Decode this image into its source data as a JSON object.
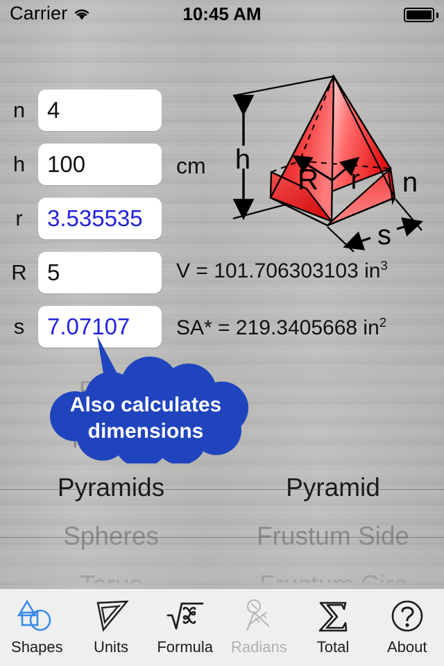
{
  "status_bar": {
    "carrier": "Carrier",
    "wifi_icon": "wifi-icon",
    "time": "10:45 AM",
    "battery_icon": "battery-icon"
  },
  "inputs": {
    "rows": [
      {
        "label": "n",
        "value": "4",
        "computed": false
      },
      {
        "label": "h",
        "value": "100",
        "computed": false
      },
      {
        "label": "r",
        "value": "3.535535",
        "computed": true
      },
      {
        "label": "R",
        "value": "5",
        "computed": false
      },
      {
        "label": "s",
        "value": "7.07107",
        "computed": true
      }
    ],
    "unit_label": "cm"
  },
  "results": {
    "volume_label": "V = ",
    "volume_value": "101.706303103",
    "volume_unit": "in",
    "volume_exponent": "3",
    "surface_label": "SA* = ",
    "surface_value": "219.3405668",
    "surface_unit": "in",
    "surface_exponent": "2"
  },
  "diagram": {
    "name": "pyramid-diagram",
    "labels": {
      "height": "h",
      "circumradius": "R",
      "inradius": "r",
      "sides": "n",
      "side": "s"
    },
    "fill_color": "#ee2222",
    "highlight_color": "#ffb3b3"
  },
  "callout": {
    "line1": "Also calculates",
    "line2": "dimensions",
    "color": "#1f44bd"
  },
  "picker": {
    "left_column": [
      {
        "label": "Pipes",
        "selected": false
      },
      {
        "label": "Prisms",
        "selected": false
      },
      {
        "label": "Pyramids",
        "selected": true
      },
      {
        "label": "Spheres",
        "selected": false
      },
      {
        "label": "Torus",
        "selected": false
      }
    ],
    "right_column": [
      {
        "label": "",
        "selected": false
      },
      {
        "label": "",
        "selected": false
      },
      {
        "label": "Pyramid",
        "selected": true
      },
      {
        "label": "Frustum Side",
        "selected": false
      },
      {
        "label": "Frustum Circ",
        "selected": false
      }
    ]
  },
  "tabbar": {
    "items": [
      {
        "label": "Shapes",
        "icon": "shapes-icon",
        "state": "active"
      },
      {
        "label": "Units",
        "icon": "ruler-icon",
        "state": "normal"
      },
      {
        "label": "Formula",
        "icon": "sqrt-icon",
        "state": "normal"
      },
      {
        "label": "Radians",
        "icon": "compass-icon",
        "state": "disabled"
      },
      {
        "label": "Total",
        "icon": "sigma-icon",
        "state": "normal"
      },
      {
        "label": "About",
        "icon": "question-icon",
        "state": "normal"
      }
    ],
    "accent_color": "#3b8bea"
  }
}
